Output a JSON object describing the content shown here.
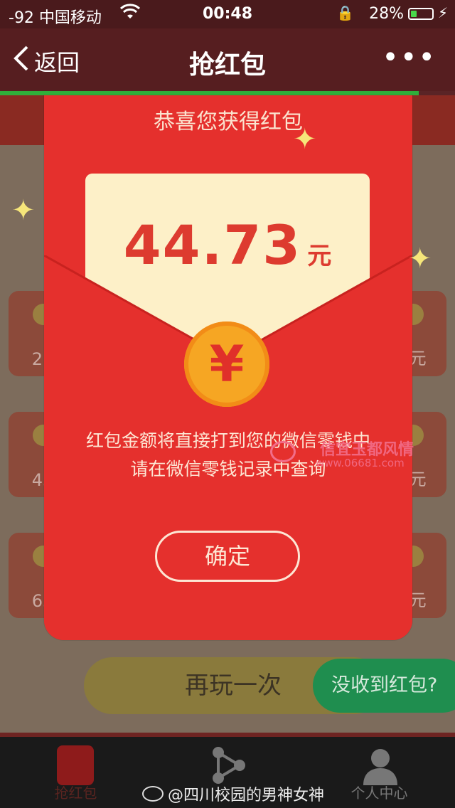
{
  "status_bar": {
    "signal": "-92 中国移动",
    "time": "00:48",
    "battery_percent": "28%",
    "battery_level": 0.28
  },
  "nav": {
    "back_label": "返回",
    "title": "抢红包"
  },
  "page": {
    "progress": 0.92,
    "background_amounts": [
      "21",
      "2元",
      "43",
      "3元",
      "65",
      "1元"
    ],
    "replay_label": "再玩一次",
    "not_received_label": "没收到红包?"
  },
  "red_packet": {
    "congrats": "恭喜您获得红包",
    "amount": "44.73",
    "unit": "元",
    "currency_symbol": "¥",
    "message_line1": "红包金额将直接打到您的微信零钱中",
    "message_line2": "请在微信零钱记录中查询",
    "confirm_label": "确定"
  },
  "watermark": {
    "name": "信宜玉都风情",
    "url": "www.06681.com"
  },
  "tab_bar": {
    "items": [
      {
        "label": "抢红包",
        "icon": "red-packet-icon"
      },
      {
        "label": "",
        "icon": "share-icon"
      },
      {
        "label": "个人中心",
        "icon": "person-icon"
      }
    ]
  },
  "weibo_credit": "@四川校园的男神女神",
  "colors": {
    "envelope_red": "#e5302d",
    "letter_cream": "#fdf0c8",
    "coin_gold": "#f6a623",
    "nav_bg": "#561e20",
    "progress_green": "#2fae3a"
  }
}
